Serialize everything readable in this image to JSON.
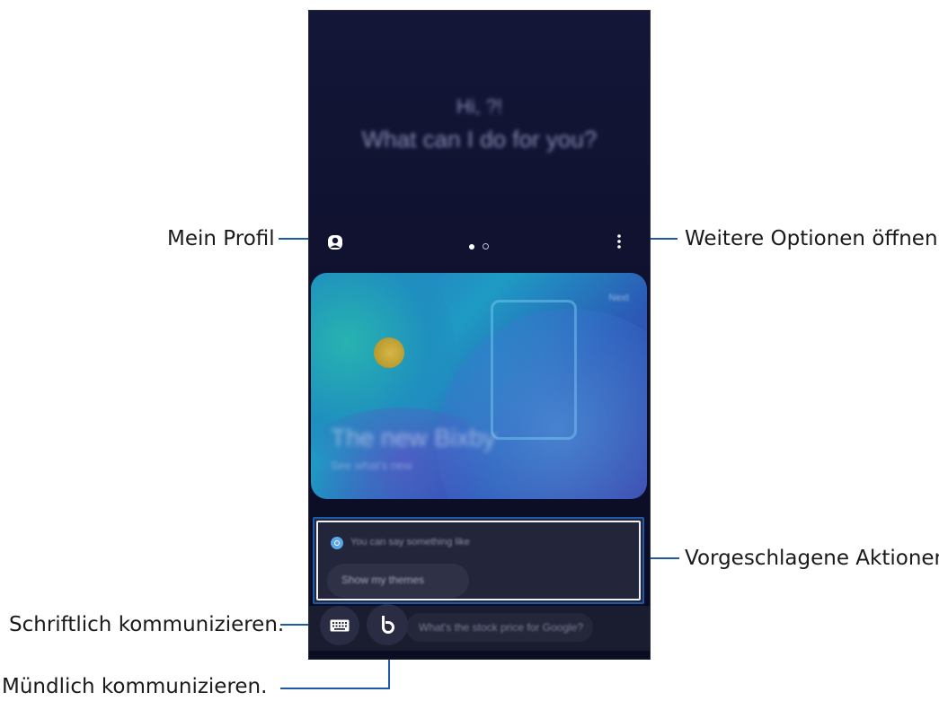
{
  "screen": {
    "greeting_line1": "Hi, ?!",
    "greeting_line2": "What can I do for you?",
    "card": {
      "tag": "Next",
      "title": "The new Bixby",
      "subtitle": "See what's new"
    },
    "suggestion": {
      "hint": "You can say something like",
      "chip_label": "Show my themes"
    },
    "ask_text": "What's the stock price for Google?"
  },
  "annotations": {
    "profile": "Mein Profil",
    "more_options": "Weitere Optionen öffnen.",
    "suggested_actions": "Vorgeschlagene Aktionen",
    "type_input": "Schriftlich kommunizieren.",
    "voice_input": "Mündlich kommunizieren."
  },
  "colors": {
    "callout_line": "#1e5aa8",
    "screen_bg": "#141638"
  },
  "icons": {
    "profile": "profile-icon",
    "more": "more-options-icon",
    "keyboard": "keyboard-icon",
    "bixby": "bixby-icon"
  }
}
